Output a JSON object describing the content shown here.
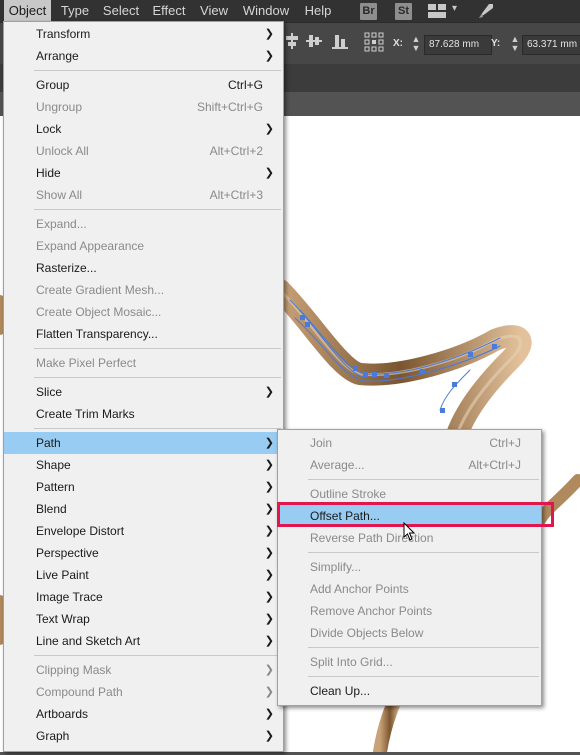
{
  "menubar": {
    "items": [
      "Object",
      "Type",
      "Select",
      "Effect",
      "View",
      "Window",
      "Help"
    ],
    "active": "Object",
    "icons": {
      "bridge": "Br",
      "stock": "St"
    }
  },
  "control_bar": {
    "x_label": "X:",
    "x_value": "87.628 mm",
    "y_label": "Y:",
    "y_value": "63.371 mm"
  },
  "object_menu": {
    "items": [
      {
        "label": "Transform",
        "shortcut": "",
        "submenu": true,
        "enabled": true
      },
      {
        "label": "Arrange",
        "shortcut": "",
        "submenu": true,
        "enabled": true
      },
      {
        "label": "Group",
        "shortcut": "Ctrl+G",
        "submenu": false,
        "enabled": true
      },
      {
        "label": "Ungroup",
        "shortcut": "Shift+Ctrl+G",
        "submenu": false,
        "enabled": false
      },
      {
        "label": "Lock",
        "shortcut": "",
        "submenu": true,
        "enabled": true
      },
      {
        "label": "Unlock All",
        "shortcut": "Alt+Ctrl+2",
        "submenu": false,
        "enabled": false
      },
      {
        "label": "Hide",
        "shortcut": "",
        "submenu": true,
        "enabled": true
      },
      {
        "label": "Show All",
        "shortcut": "Alt+Ctrl+3",
        "submenu": false,
        "enabled": false
      },
      {
        "label": "Expand...",
        "shortcut": "",
        "submenu": false,
        "enabled": false
      },
      {
        "label": "Expand Appearance",
        "shortcut": "",
        "submenu": false,
        "enabled": false
      },
      {
        "label": "Rasterize...",
        "shortcut": "",
        "submenu": false,
        "enabled": true
      },
      {
        "label": "Create Gradient Mesh...",
        "shortcut": "",
        "submenu": false,
        "enabled": false
      },
      {
        "label": "Create Object Mosaic...",
        "shortcut": "",
        "submenu": false,
        "enabled": false
      },
      {
        "label": "Flatten Transparency...",
        "shortcut": "",
        "submenu": false,
        "enabled": true
      },
      {
        "label": "Make Pixel Perfect",
        "shortcut": "",
        "submenu": false,
        "enabled": false
      },
      {
        "label": "Slice",
        "shortcut": "",
        "submenu": true,
        "enabled": true
      },
      {
        "label": "Create Trim Marks",
        "shortcut": "",
        "submenu": false,
        "enabled": true
      },
      {
        "label": "Path",
        "shortcut": "",
        "submenu": true,
        "enabled": true,
        "highlighted": true
      },
      {
        "label": "Shape",
        "shortcut": "",
        "submenu": true,
        "enabled": true
      },
      {
        "label": "Pattern",
        "shortcut": "",
        "submenu": true,
        "enabled": true
      },
      {
        "label": "Blend",
        "shortcut": "",
        "submenu": true,
        "enabled": true
      },
      {
        "label": "Envelope Distort",
        "shortcut": "",
        "submenu": true,
        "enabled": true
      },
      {
        "label": "Perspective",
        "shortcut": "",
        "submenu": true,
        "enabled": true
      },
      {
        "label": "Live Paint",
        "shortcut": "",
        "submenu": true,
        "enabled": true
      },
      {
        "label": "Image Trace",
        "shortcut": "",
        "submenu": true,
        "enabled": true
      },
      {
        "label": "Text Wrap",
        "shortcut": "",
        "submenu": true,
        "enabled": true
      },
      {
        "label": "Line and Sketch Art",
        "shortcut": "",
        "submenu": true,
        "enabled": true
      },
      {
        "label": "Clipping Mask",
        "shortcut": "",
        "submenu": true,
        "enabled": false
      },
      {
        "label": "Compound Path",
        "shortcut": "",
        "submenu": true,
        "enabled": false
      },
      {
        "label": "Artboards",
        "shortcut": "",
        "submenu": true,
        "enabled": true
      },
      {
        "label": "Graph",
        "shortcut": "",
        "submenu": true,
        "enabled": true
      }
    ]
  },
  "path_submenu": {
    "items": [
      {
        "label": "Join",
        "shortcut": "Ctrl+J",
        "enabled": false
      },
      {
        "label": "Average...",
        "shortcut": "Alt+Ctrl+J",
        "enabled": false
      },
      {
        "label": "Outline Stroke",
        "shortcut": "",
        "enabled": false
      },
      {
        "label": "Offset Path...",
        "shortcut": "",
        "enabled": true,
        "highlighted": true
      },
      {
        "label": "Reverse Path Direction",
        "shortcut": "",
        "enabled": false
      },
      {
        "label": "Simplify...",
        "shortcut": "",
        "enabled": false
      },
      {
        "label": "Add Anchor Points",
        "shortcut": "",
        "enabled": false
      },
      {
        "label": "Remove Anchor Points",
        "shortcut": "",
        "enabled": false
      },
      {
        "label": "Divide Objects Below",
        "shortcut": "",
        "enabled": false
      },
      {
        "label": "Split Into Grid...",
        "shortcut": "",
        "enabled": false
      },
      {
        "label": "Clean Up...",
        "shortcut": "",
        "enabled": true
      }
    ]
  },
  "colors": {
    "highlight": "#99ccf2",
    "callout": "#e0164e",
    "artwork_stroke": "#b08a5c",
    "anchor": "#4a7bd8"
  }
}
